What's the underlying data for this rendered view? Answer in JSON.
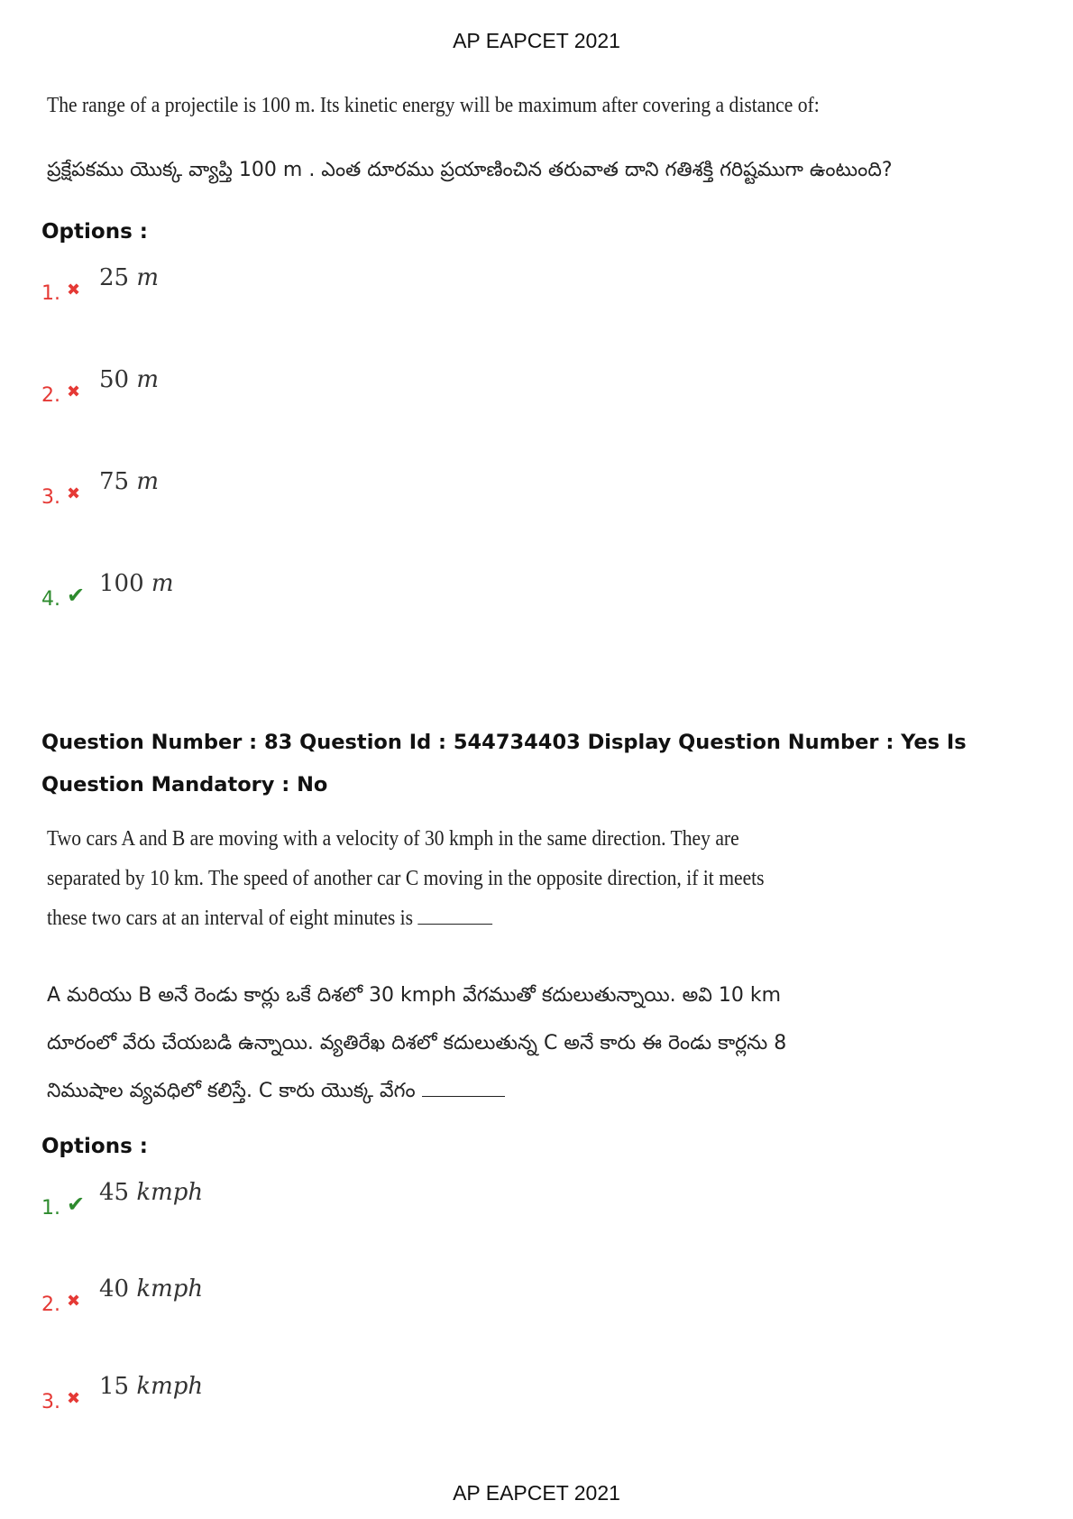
{
  "header": "AP EAPCET 2021",
  "footer": "AP EAPCET 2021",
  "q82": {
    "english": "The range of a projectile is 100 m. Its kinetic energy will be maximum after covering a distance of:",
    "telugu": "ప్రక్షేపకము యొక్క వ్యాప్తి 100 m . ఎంత దూరము ప్రయాణించిన తరువాత దాని గతిశక్తి గరిష్టముగా ఉంటుంది?",
    "options_label": "Options :",
    "options": [
      {
        "num": "1.",
        "status": "wrong",
        "value": "25",
        "unit": "m"
      },
      {
        "num": "2.",
        "status": "wrong",
        "value": "50",
        "unit": "m"
      },
      {
        "num": "3.",
        "status": "wrong",
        "value": "75",
        "unit": "m"
      },
      {
        "num": "4.",
        "status": "correct",
        "value": "100",
        "unit": "m"
      }
    ]
  },
  "q83": {
    "meta": "Question Number : 83 Question Id : 544734403 Display Question Number : Yes Is Question Mandatory : No",
    "english_lines": [
      "Two cars A and B are moving with a velocity of  30 kmph in the same direction. They are",
      "separated by 10 km. The speed of another car C moving in the opposite direction, if it meets",
      "these two cars at an interval of eight minutes is"
    ],
    "telugu_lines": [
      "A మరియు B అనే రెండు కార్లు ఒకే దిశలో  30 kmph వేగముతో కదులుతున్నాయి. అవి 10 km",
      "దూరంలో వేరు చేయబడి ఉన్నాయి. వ్యతిరేఖ దిశలో కదులుతున్న C అనే కారు ఈ రెండు కార్లను 8",
      "నిముషాల వ్యవధిలో కలిస్తే. C కారు యొక్క వేగం"
    ],
    "options_label": "Options :",
    "options": [
      {
        "num": "1.",
        "status": "correct",
        "value": "45",
        "unit": "kmph"
      },
      {
        "num": "2.",
        "status": "wrong",
        "value": "40",
        "unit": "kmph"
      },
      {
        "num": "3.",
        "status": "wrong",
        "value": "15",
        "unit": "kmph"
      }
    ]
  },
  "icons": {
    "wrong": "cross-icon",
    "correct": "check-icon"
  },
  "colors": {
    "wrong": "#e53935",
    "correct": "#2e8b2e"
  }
}
